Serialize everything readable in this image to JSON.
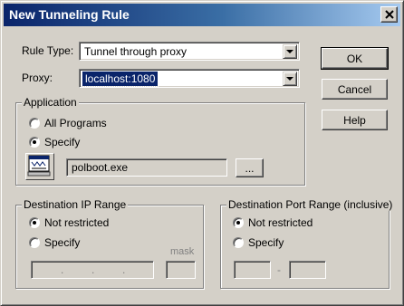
{
  "window": {
    "title": "New Tunneling Rule"
  },
  "rule_type": {
    "label": "Rule Type:",
    "value": "Tunnel through proxy"
  },
  "proxy": {
    "label": "Proxy:",
    "value": "localhost:1080"
  },
  "buttons": {
    "ok": "OK",
    "cancel": "Cancel",
    "help": "Help"
  },
  "application": {
    "title": "Application",
    "all_programs": "All Programs",
    "specify": "Specify",
    "selected": "specify",
    "program_path": "polboot.exe",
    "browse": "..."
  },
  "dest_ip": {
    "title": "Destination IP Range",
    "not_restricted": "Not restricted",
    "specify": "Specify",
    "selected": "not_restricted",
    "mask_label": "mask",
    "ip_separator": "."
  },
  "dest_port": {
    "title": "Destination Port Range (inclusive)",
    "not_restricted": "Not restricted",
    "specify": "Specify",
    "selected": "not_restricted",
    "range_separator": "-"
  },
  "colors": {
    "title_bar": "#0a246a",
    "selection": "#0a246a",
    "face": "#d4d0c8"
  }
}
